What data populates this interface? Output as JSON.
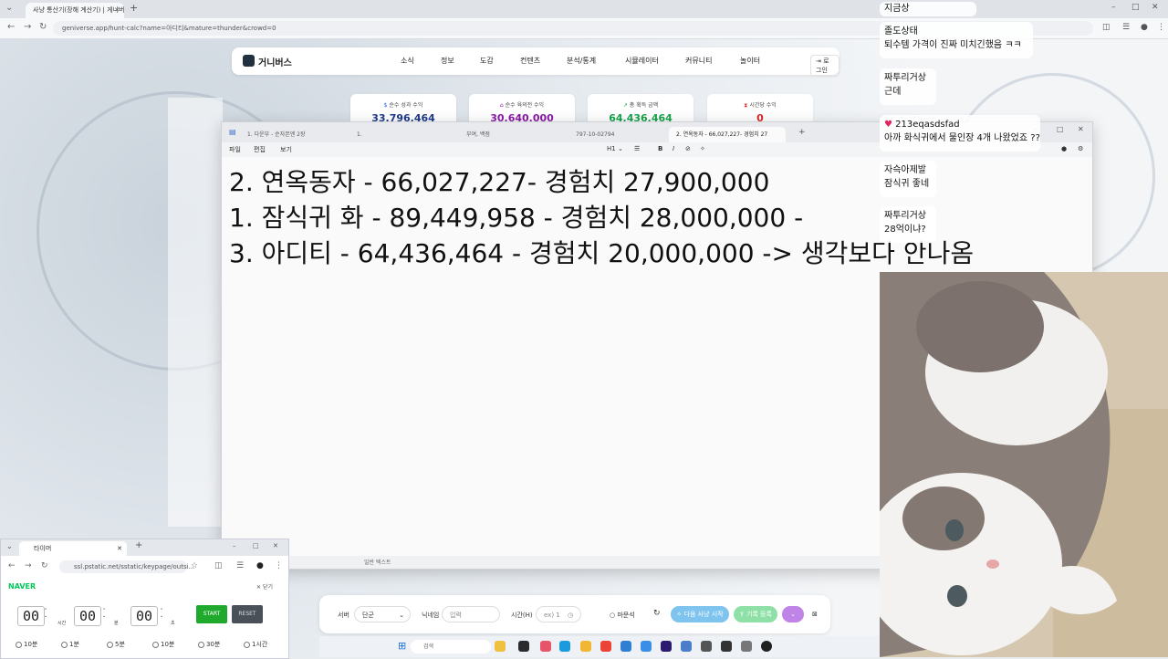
{
  "browser": {
    "tab_title": "사냥 통산기(장해 계산기) | 게니버스",
    "url": "geniverse.app/hunt-calc?name=아디티&mature=thunder&crowd=0"
  },
  "site": {
    "logo": "거니버스",
    "menu": [
      "소식",
      "정보",
      "도감",
      "컨텐츠",
      "분석/통계",
      "시뮬레이터",
      "커뮤니티",
      "놀이터"
    ],
    "login": "로그인"
  },
  "stats": [
    {
      "label": "순수 성과 수익",
      "value": "33,796,464",
      "color": "#1e3a8a"
    },
    {
      "label": "순수 육의전 수익",
      "value": "30,640,000",
      "color": "#8b1aa8"
    },
    {
      "label": "총 획득 금액",
      "value": "64,436,464",
      "color": "#16a34a"
    },
    {
      "label": "시간당 수익",
      "value": "0",
      "color": "#dc2626"
    }
  ],
  "editor": {
    "tabs": [
      "1. 다운부 - 순자본엔 2장",
      "1.",
      "부여, 백점",
      "797-10-02794",
      "2. 연옥동자 - 66,027,227- 경험치 27"
    ],
    "menu": [
      "파일",
      "편집",
      "보기"
    ],
    "lines": [
      "2. 연옥동자 - 66,027,227- 경험치 27,900,000",
      "1. 잠식귀 화 - 89,449,958 - 경험치 28,000,000 -",
      "3. 아디티 - 64,436,464 - 경험치 20,000,000 -> 생각보다 안나옴"
    ],
    "status": "일반 텍스트"
  },
  "controls": {
    "server_label": "서버",
    "server_value": "단군",
    "nickname_label": "닉네임",
    "nickname_placeholder": "입력",
    "time_label": "시간(H)",
    "time_placeholder": "ex) 1",
    "bonus_label": "마문석",
    "start_label": "다음 사냥 시작",
    "record_label": "기록 등록"
  },
  "timer": {
    "tab_title": "타이머",
    "url": "ssl.pstatic.net/sstatic/keypage/outsi...",
    "brand": "NAVER",
    "close_label": "닫기",
    "hours": "00",
    "minutes": "00",
    "seconds": "00",
    "unit_h": "시간",
    "unit_m": "분",
    "unit_s": "초",
    "start": "START",
    "reset": "RESET",
    "presets": [
      "10분",
      "1분",
      "5분",
      "10분",
      "30분",
      "1시간"
    ]
  },
  "taskbar": {
    "search_placeholder": "검색"
  },
  "chat": [
    {
      "user": "",
      "text": "지금상"
    },
    {
      "user": "졸도상태",
      "text": "퇴수템 가격이 진짜 미치긴했음 ㅋㅋ"
    },
    {
      "user": "짜투리거상",
      "text": "근데"
    },
    {
      "user": "213eqasdsfad",
      "text": "아까 화식귀에서 물인장 4개 나왔었죠 ??"
    },
    {
      "user": "자슥아제발",
      "text": "잠식귀 좋네"
    },
    {
      "user": "짜투리거상",
      "text": "28억이냐?"
    }
  ]
}
